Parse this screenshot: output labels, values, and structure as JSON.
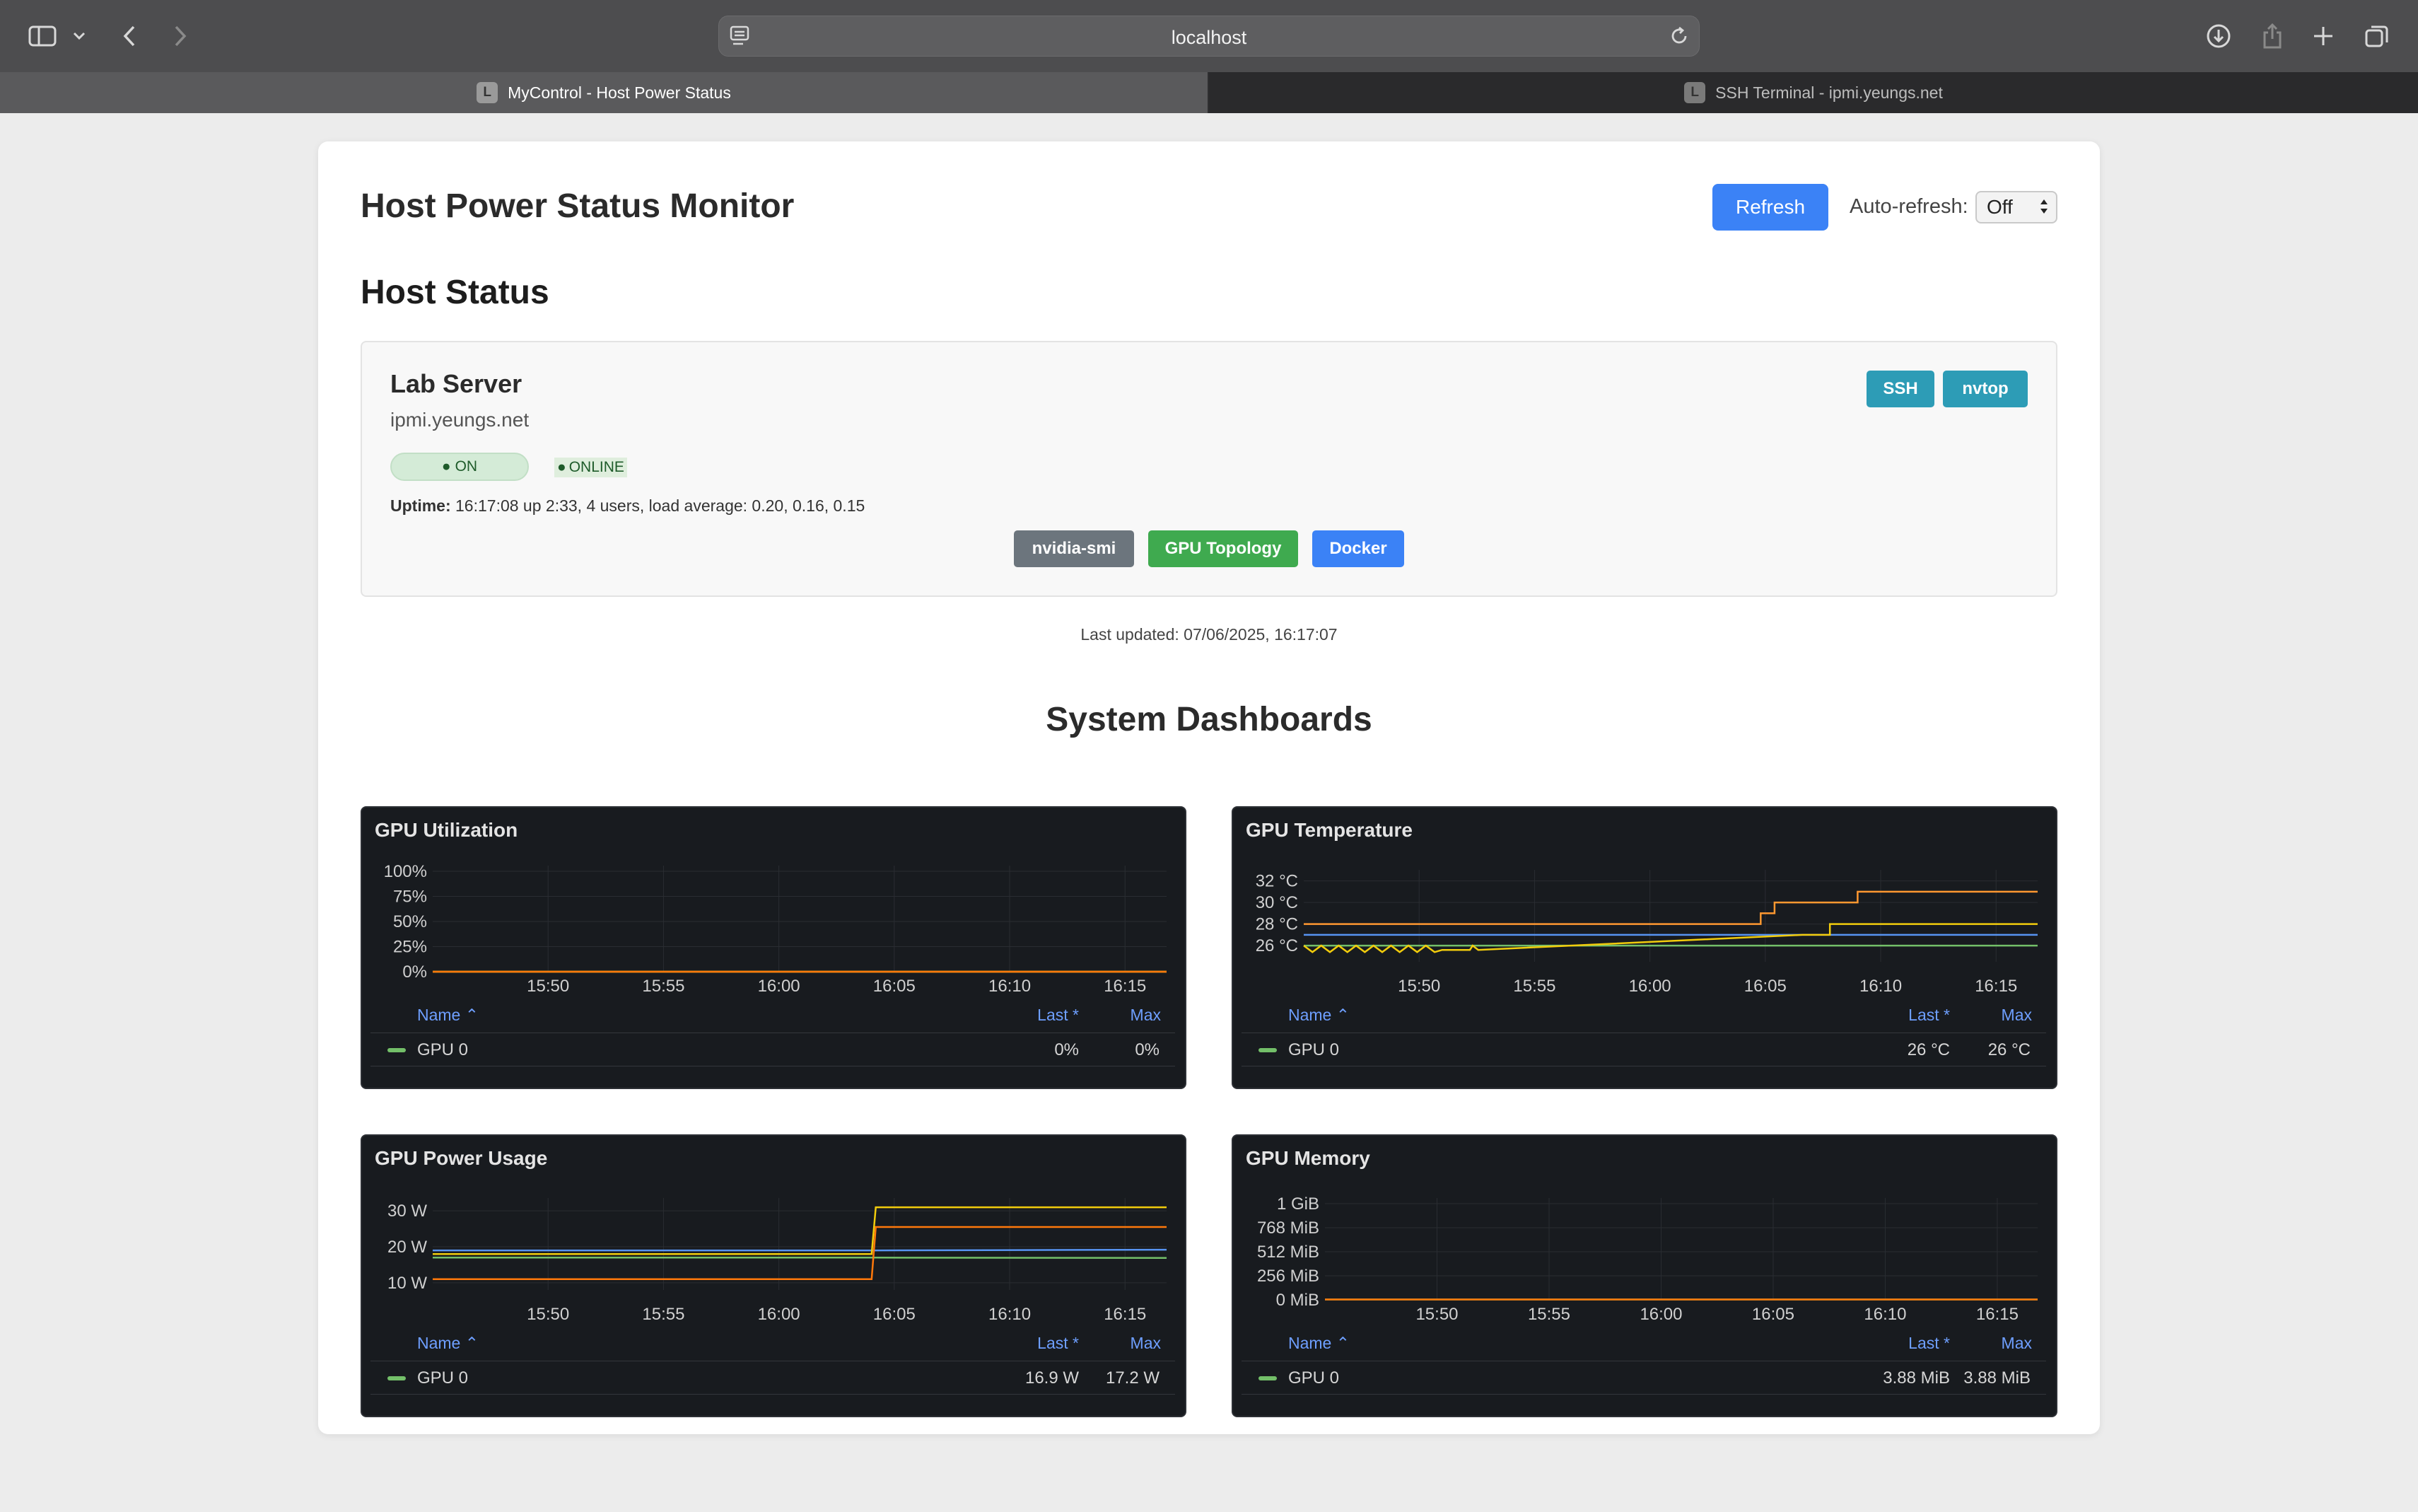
{
  "browser": {
    "url": "localhost",
    "tabs": [
      {
        "favicon": "L",
        "title": "MyControl - Host Power Status"
      },
      {
        "favicon": "L",
        "title": "SSH Terminal - ipmi.yeungs.net"
      }
    ]
  },
  "header": {
    "title": "Host Power Status Monitor",
    "refresh_label": "Refresh",
    "auto_refresh_label": "Auto-refresh:",
    "auto_refresh_value": "Off"
  },
  "host_status": {
    "heading": "Host Status",
    "host": {
      "name": "Lab Server",
      "address": "ipmi.yeungs.net",
      "power_badge": "ON",
      "online_badge": "ONLINE",
      "uptime_label": "Uptime:",
      "uptime_value": "16:17:08 up 2:33, 4 users, load average: 0.20, 0.16, 0.15",
      "ssh_label": "SSH",
      "nvtop_label": "nvtop",
      "nvidia_smi_label": "nvidia-smi",
      "gpu_topology_label": "GPU Topology",
      "docker_label": "Docker"
    },
    "last_updated": "Last updated: 07/06/2025, 16:17:07"
  },
  "dashboards": {
    "heading": "System Dashboards",
    "legend_headers": {
      "name": "Name",
      "last": "Last *",
      "max": "Max"
    },
    "panels": {
      "util": {
        "title": "GPU Utilization",
        "gpu_name": "GPU 0",
        "last": "0%",
        "max": "0%"
      },
      "temp": {
        "title": "GPU Temperature",
        "gpu_name": "GPU 0",
        "last": "26 °C",
        "max": "26 °C"
      },
      "power": {
        "title": "GPU Power Usage",
        "gpu_name": "GPU 0",
        "last": "16.9 W",
        "max": "17.2 W"
      },
      "mem": {
        "title": "GPU Memory",
        "gpu_name": "GPU 0",
        "last": "3.88 MiB",
        "max": "3.88 MiB"
      }
    }
  },
  "chart_data": [
    {
      "type": "line",
      "title": "GPU Utilization",
      "x_ticks": [
        "15:50",
        "15:55",
        "16:00",
        "16:05",
        "16:10",
        "16:15"
      ],
      "y_ticks": [
        "0%",
        "25%",
        "50%",
        "75%",
        "100%"
      ],
      "ylim": [
        0,
        100
      ],
      "xlim": [
        15.75,
        16.28
      ],
      "series": [
        {
          "name": "GPU 0",
          "color": "#73bf69",
          "x": [
            15.75,
            16.28
          ],
          "values": [
            0,
            0
          ]
        },
        {
          "color": "#f2cc0c",
          "x": [
            15.75,
            16.28
          ],
          "values": [
            0,
            0
          ]
        },
        {
          "color": "#ff780a",
          "x": [
            15.75,
            16.28
          ],
          "values": [
            0,
            0
          ]
        }
      ]
    },
    {
      "type": "line",
      "title": "GPU Temperature",
      "x_ticks": [
        "15:50",
        "15:55",
        "16:00",
        "16:05",
        "16:10",
        "16:15"
      ],
      "y_ticks": [
        "26 °C",
        "28 °C",
        "30 °C",
        "32 °C"
      ],
      "ylim": [
        24.5,
        32.5
      ],
      "xlim": [
        15.75,
        16.28
      ],
      "series": [
        {
          "name": "GPU 0",
          "color": "#73bf69",
          "x": [
            15.75,
            16.28
          ],
          "values": [
            26,
            26
          ]
        },
        {
          "color": "#ff9830",
          "x": [
            15.75,
            16.05,
            16.08,
            16.09,
            16.11,
            16.15,
            16.28
          ],
          "values": [
            28,
            28,
            29,
            30,
            30,
            31,
            31
          ]
        },
        {
          "color": "#5794f2",
          "x": [
            15.75,
            16.28
          ],
          "values": [
            27,
            27
          ]
        },
        {
          "color": "#f2cc0c",
          "x": [
            15.75,
            15.85,
            15.87,
            16.08,
            16.09,
            16.11,
            16.13,
            16.28
          ],
          "values": [
            26,
            25.6,
            25.6,
            25.6,
            27,
            27,
            28,
            28
          ]
        }
      ]
    },
    {
      "type": "line",
      "title": "GPU Power Usage",
      "x_ticks": [
        "15:50",
        "15:55",
        "16:00",
        "16:05",
        "16:10",
        "16:15"
      ],
      "y_ticks": [
        "10 W",
        "20 W",
        "30 W"
      ],
      "ylim": [
        8,
        32
      ],
      "xlim": [
        15.75,
        16.28
      ],
      "series": [
        {
          "name": "GPU 0",
          "color": "#73bf69",
          "x": [
            15.75,
            16.067,
            16.07,
            16.28
          ],
          "values": [
            17,
            17,
            17,
            16.9
          ]
        },
        {
          "color": "#5794f2",
          "x": [
            15.75,
            16.067,
            16.07,
            16.28
          ],
          "values": [
            19,
            19,
            19,
            19.2
          ]
        },
        {
          "color": "#f2cc0c",
          "x": [
            15.75,
            16.067,
            16.07,
            16.28
          ],
          "values": [
            18,
            18,
            31,
            31
          ]
        },
        {
          "color": "#ff780a",
          "x": [
            15.75,
            16.067,
            16.07,
            16.28
          ],
          "values": [
            11,
            11,
            25.5,
            25.5
          ]
        }
      ]
    },
    {
      "type": "line",
      "title": "GPU Memory",
      "x_ticks": [
        "15:50",
        "15:55",
        "16:00",
        "16:05",
        "16:10",
        "16:15"
      ],
      "y_ticks": [
        "0 MiB",
        "256 MiB",
        "512 MiB",
        "768 MiB",
        "1 GiB"
      ],
      "ylim": [
        0,
        1024
      ],
      "xlim": [
        15.75,
        16.28
      ],
      "series": [
        {
          "name": "GPU 0",
          "color": "#73bf69",
          "x": [
            15.75,
            16.28
          ],
          "values": [
            3.88,
            3.88
          ]
        },
        {
          "color": "#ff780a",
          "x": [
            15.75,
            16.28
          ],
          "values": [
            3.88,
            3.88
          ]
        }
      ]
    }
  ]
}
